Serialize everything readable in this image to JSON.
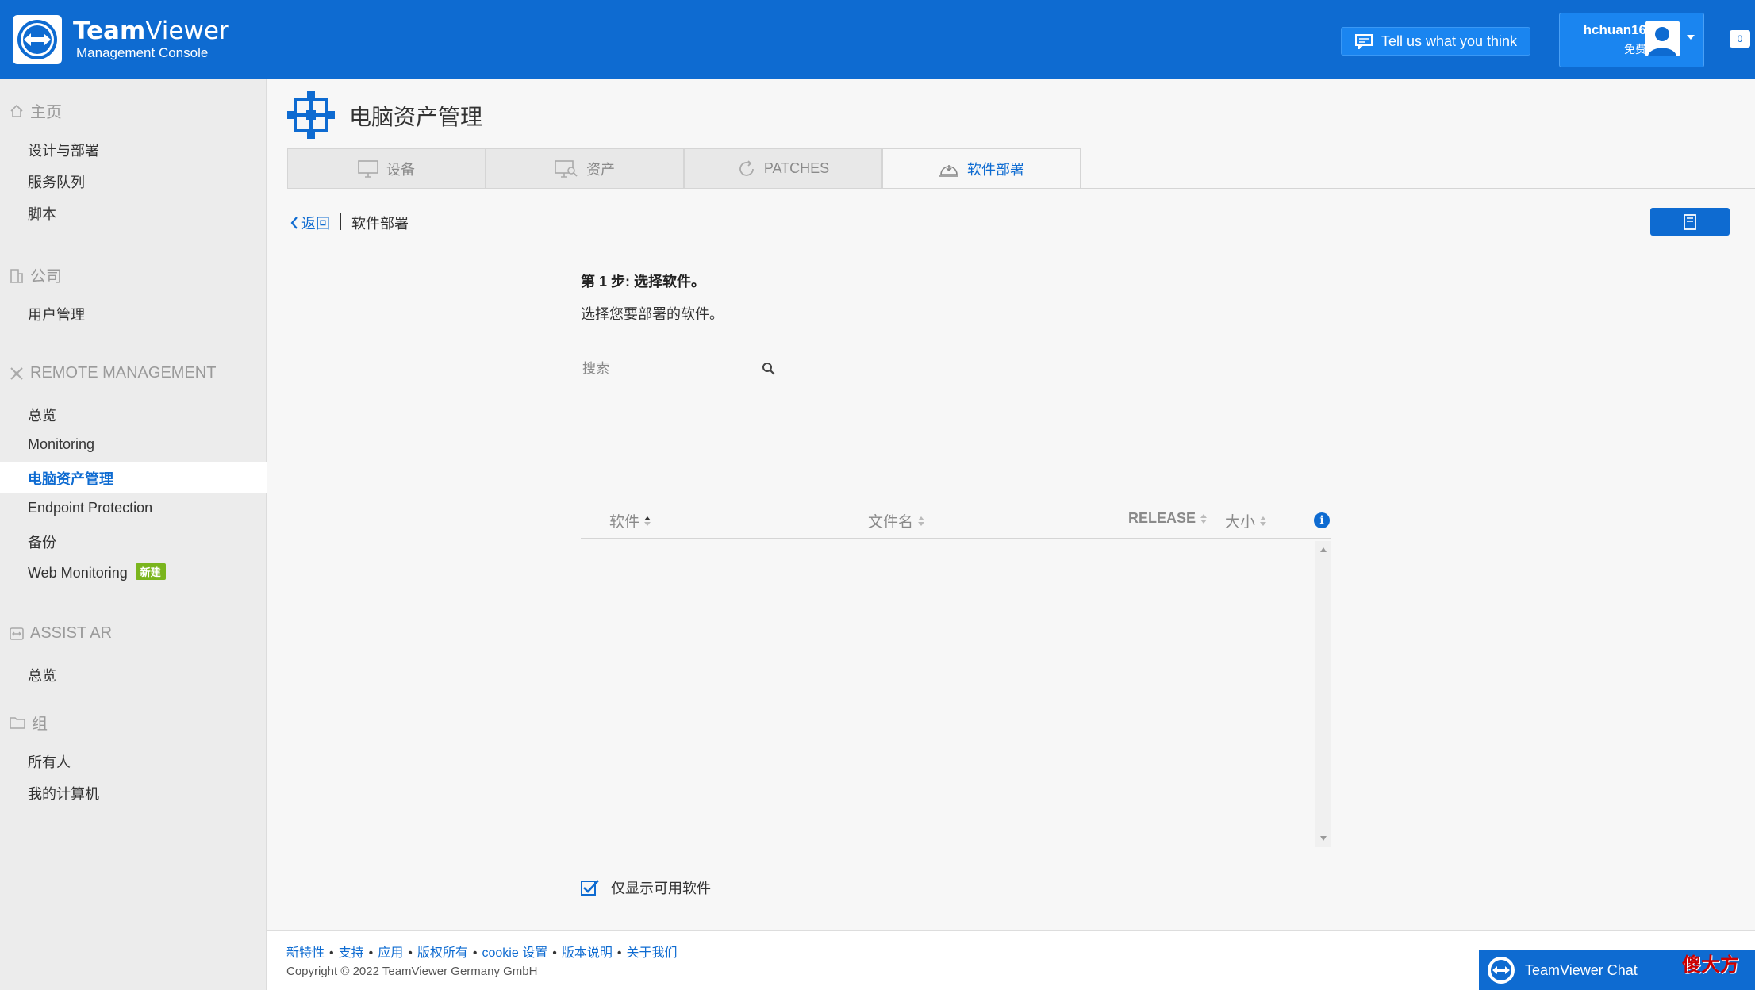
{
  "header": {
    "brand_bold": "Team",
    "brand_regular": "Viewer",
    "brand_sub": "Management Console",
    "feedback_label": "Tell us what you think",
    "user_name": "hchuan16",
    "user_plan": "免费",
    "notifications": "0"
  },
  "sidebar": {
    "home": {
      "title": "主页",
      "items": [
        "设计与部署",
        "服务队列",
        "脚本"
      ]
    },
    "company": {
      "title": "公司",
      "items": [
        "用户管理"
      ]
    },
    "remote": {
      "title": "REMOTE MANAGEMENT",
      "items": [
        "总览",
        "Monitoring",
        "电脑资产管理",
        "Endpoint Protection",
        "备份",
        "Web Monitoring"
      ],
      "active_index": 2,
      "new_badge": "新建"
    },
    "assist": {
      "title": "ASSIST AR",
      "items": [
        "总览"
      ]
    },
    "groups": {
      "title": "组",
      "items": [
        "所有人",
        "我的计算机"
      ]
    }
  },
  "page": {
    "title": "电脑资产管理",
    "tabs": [
      "设备",
      "资产",
      "PATCHES",
      "软件部署"
    ],
    "active_tab": 3,
    "back_label": "返回",
    "breadcrumb_current": "软件部署"
  },
  "step": {
    "title": "第 1 步: 选择软件。",
    "description": "选择您要部署的软件。",
    "search_placeholder": "搜索"
  },
  "grid": {
    "columns": [
      "软件",
      "文件名",
      "RELEASE",
      "大小"
    ],
    "rows": []
  },
  "filter": {
    "only_available_label": "仅显示可用软件",
    "checked": true
  },
  "footer": {
    "links": [
      "新特性",
      "支持",
      "应用",
      "版权所有",
      "cookie 设置",
      "版本说明",
      "关于我们"
    ],
    "copyright": "Copyright © 2022 TeamViewer Germany GmbH"
  },
  "chat": {
    "label": "TeamViewer Chat"
  },
  "watermark": "傻大方",
  "colors": {
    "brand_blue": "#0e6bd1",
    "badge_green": "#7ab51d"
  }
}
